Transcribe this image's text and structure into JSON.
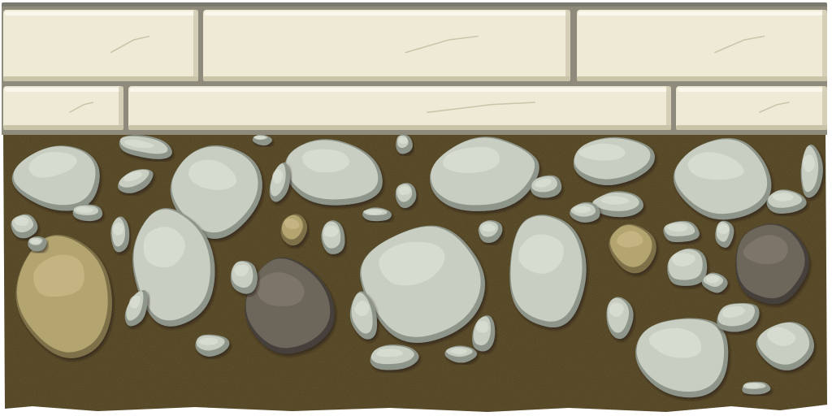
{
  "scene": {
    "title": "",
    "kind": "stone-wall-tile"
  },
  "colors": {
    "background": "#ffffff",
    "brick_fill": "#efead5",
    "brick_highlight": "#faf8ec",
    "brick_shadow": "#c9c3a8",
    "mortar": "#8f8b7c",
    "top_strip": "#7a7a70",
    "dirt": "#4d3f1e",
    "dirt_dark": "#3b2f14",
    "stone_gray": "#c8cec1",
    "stone_gray_light": "#e4e8df",
    "stone_gray_edge": "#8e958a",
    "stone_tan": "#b4a570",
    "stone_tan_light": "#cfc190",
    "stone_tan_edge": "#7e7148",
    "stone_brown": "#6d665a",
    "stone_brown_light": "#8a8275",
    "stone_brown_edge": "#45403a"
  }
}
